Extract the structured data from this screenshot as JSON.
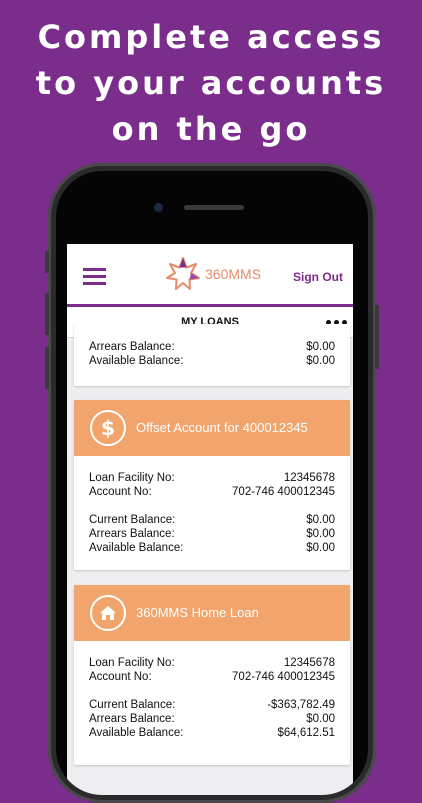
{
  "headline": [
    "Complete access",
    "to your accounts",
    "on the go"
  ],
  "app": {
    "brand": "360MMS",
    "sign_out": "Sign Out",
    "tab_title": "MY LOANS",
    "menu_icon": "hamburger-menu-icon",
    "more_icon": "more-options-icon"
  },
  "colors": {
    "background": "#7b2d8b",
    "accent": "#7b2d8b",
    "card_header": "#f1a46c"
  },
  "partial_card": {
    "rows": [
      {
        "label": "Arrears Balance:",
        "value": "$0.00"
      },
      {
        "label": "Available Balance:",
        "value": "$0.00"
      }
    ]
  },
  "cards": [
    {
      "title": "Offset Account for 400012345",
      "icon": "dollar-icon",
      "rows_a": [
        {
          "label": "Loan Facility No:",
          "value": "12345678"
        },
        {
          "label": "Account No:",
          "value": "702-746 400012345"
        }
      ],
      "rows_b": [
        {
          "label": "Current Balance:",
          "value": "$0.00"
        },
        {
          "label": "Arrears Balance:",
          "value": "$0.00"
        },
        {
          "label": "Available Balance:",
          "value": "$0.00"
        }
      ]
    },
    {
      "title": "360MMS Home Loan",
      "icon": "home-icon",
      "rows_a": [
        {
          "label": "Loan Facility No:",
          "value": "12345678"
        },
        {
          "label": "Account No:",
          "value": "702-746 400012345"
        }
      ],
      "rows_b": [
        {
          "label": "Current Balance:",
          "value": "-$363,782.49"
        },
        {
          "label": "Arrears Balance:",
          "value": "$0.00"
        },
        {
          "label": "Available Balance:",
          "value": "$64,612.51"
        }
      ]
    }
  ]
}
